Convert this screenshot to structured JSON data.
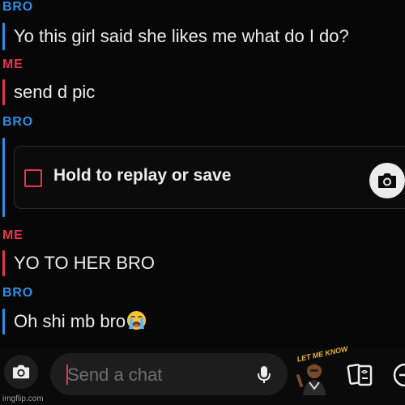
{
  "messages": [
    {
      "sender": "BRO",
      "text": "Yo this girl said she likes me what do I do?"
    },
    {
      "sender": "ME",
      "text": "send d pic"
    },
    {
      "sender": "BRO",
      "snap_label": "Hold to replay or save"
    },
    {
      "sender": "ME",
      "text": "YO TO HER BRO"
    },
    {
      "sender": "BRO",
      "text": "Oh shi mb bro",
      "emoji": "loudly-crying-face"
    }
  ],
  "composer": {
    "placeholder": "Send a chat",
    "sticker_text": "LET ME KNOW"
  },
  "watermark": "imgflip.com",
  "colors": {
    "bro": "#2f8fe6",
    "me": "#e2374f",
    "background": "#070707",
    "text": "#ececec"
  }
}
